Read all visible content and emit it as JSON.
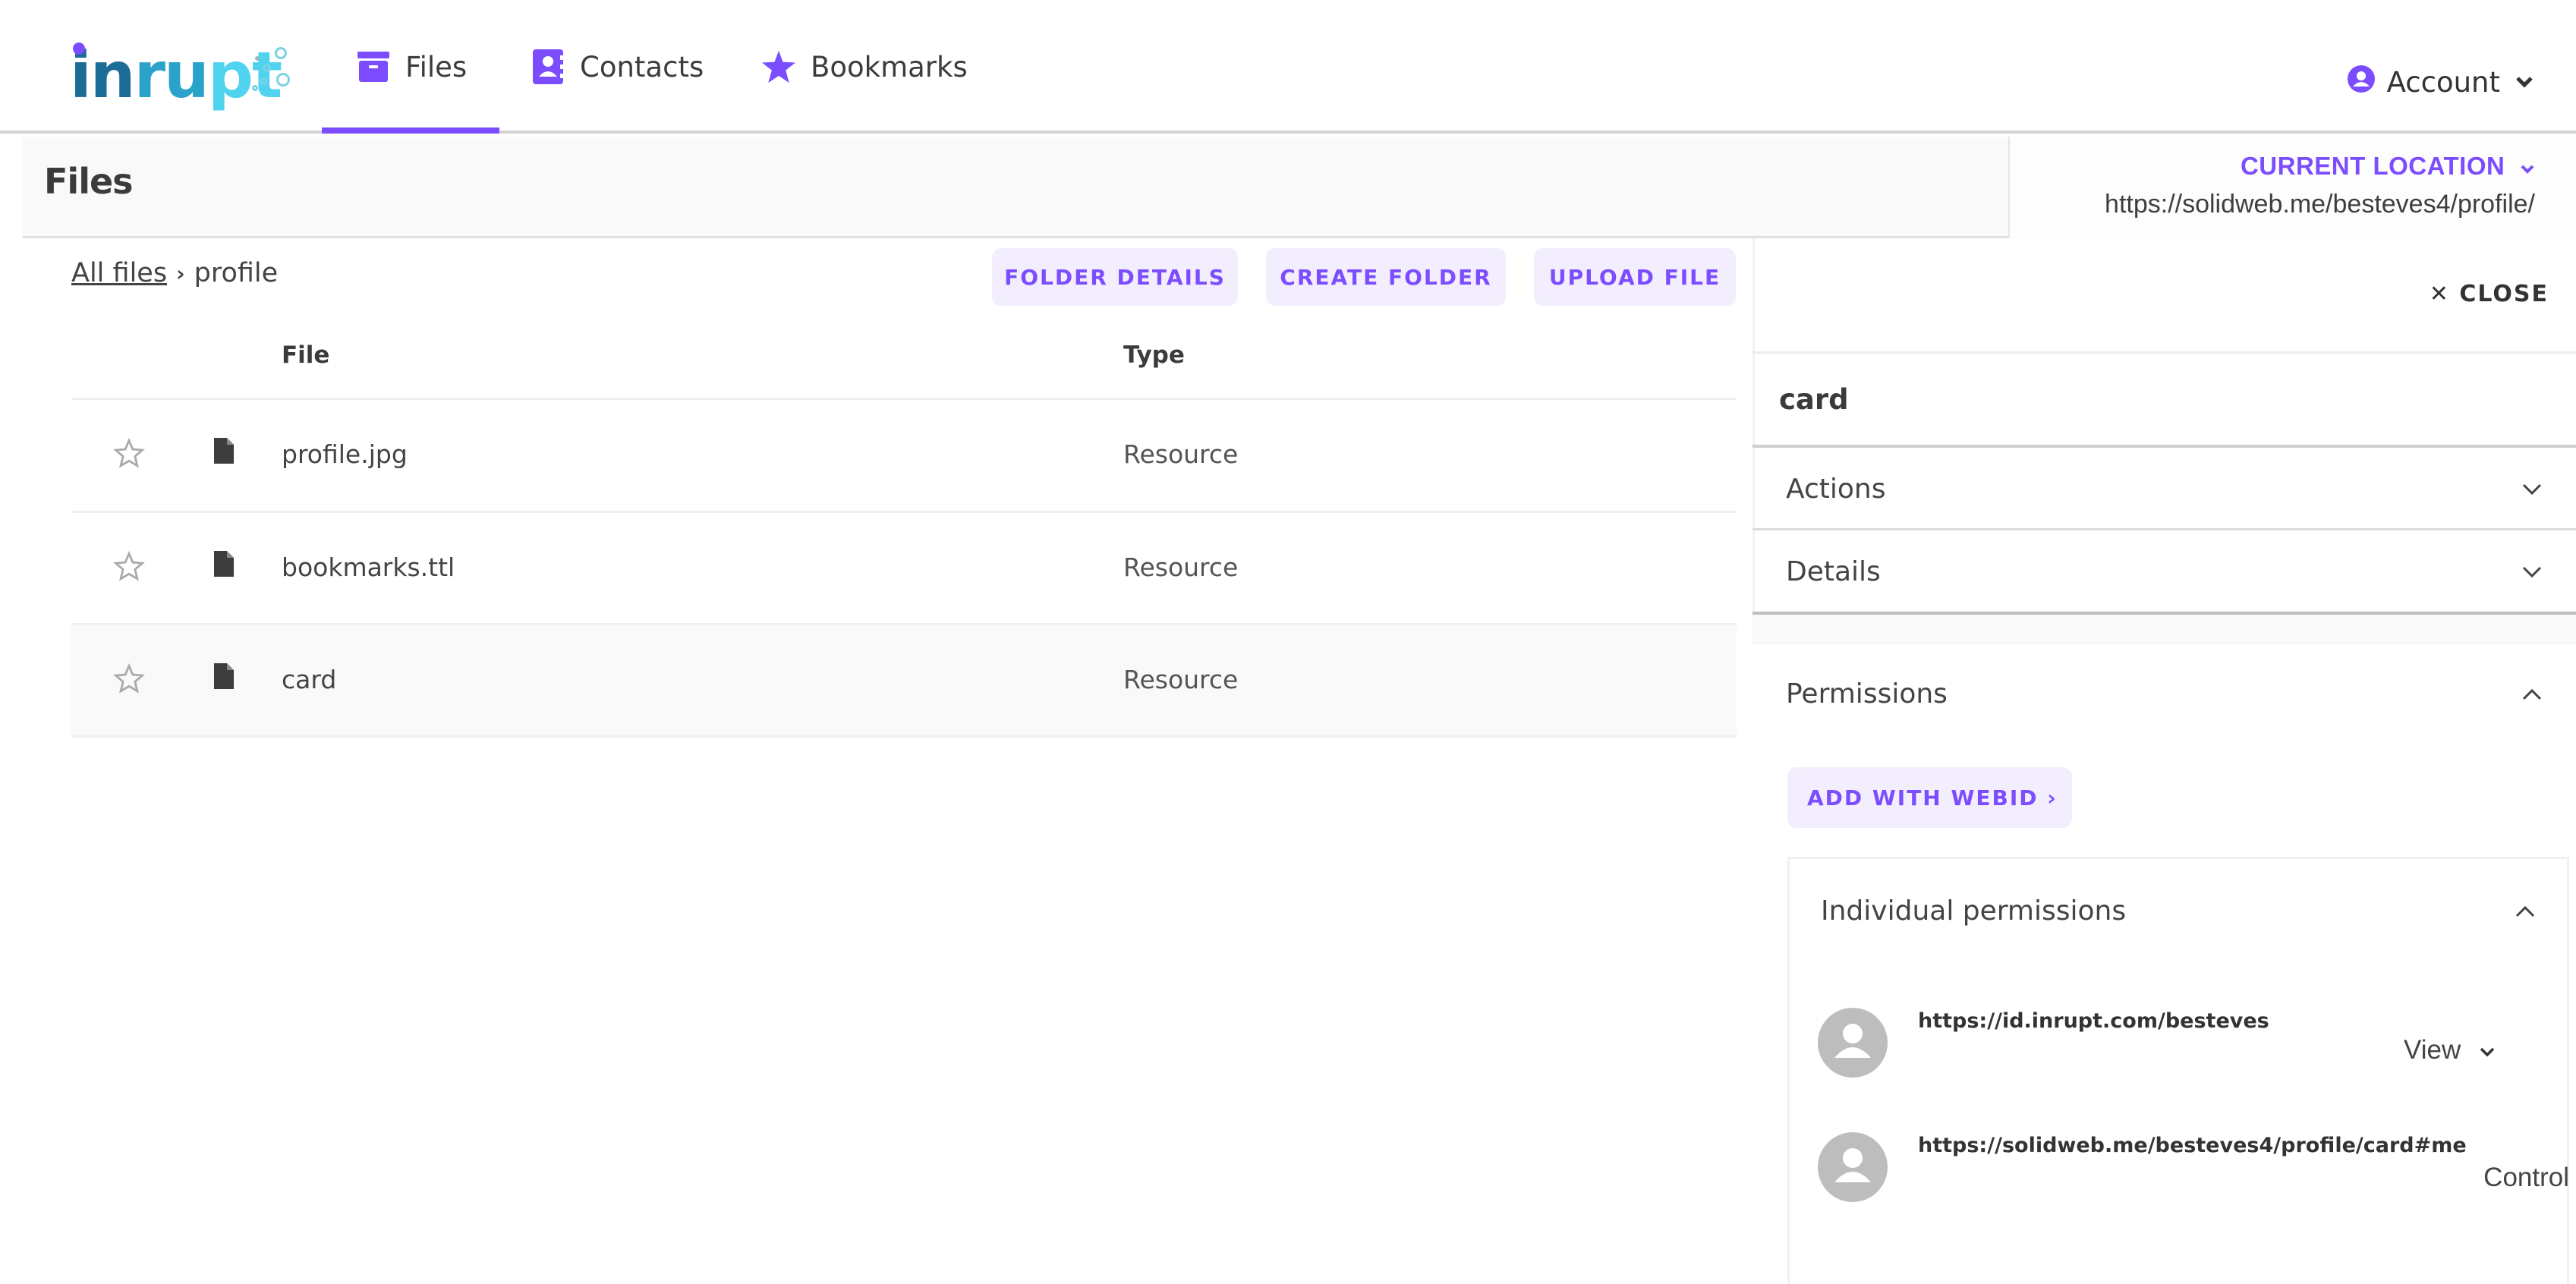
{
  "brand": {
    "logo_text_1": "in",
    "logo_text_2": "ru",
    "logo_text_3": "pt",
    "accent": "#7c4dff"
  },
  "nav": {
    "tabs": [
      {
        "label": "Files",
        "icon": "archive-box-icon",
        "active": true
      },
      {
        "label": "Contacts",
        "icon": "contact-book-icon",
        "active": false
      },
      {
        "label": "Bookmarks",
        "icon": "star-icon",
        "active": false
      }
    ],
    "account_label": "Account"
  },
  "header": {
    "title": "Files",
    "current_location_label": "CURRENT LOCATION",
    "current_location_url": "https://solidweb.me/besteves4/profile/"
  },
  "breadcrumb": {
    "root": "All files",
    "separator": "›",
    "current": "profile"
  },
  "toolbar": {
    "folder_details": "FOLDER DETAILS",
    "create_folder": "CREATE FOLDER",
    "upload_file": "UPLOAD FILE"
  },
  "table": {
    "columns": [
      "File",
      "Type"
    ],
    "rows": [
      {
        "name": "profile.jpg",
        "type": "Resource",
        "selected": false
      },
      {
        "name": "bookmarks.ttl",
        "type": "Resource",
        "selected": false
      },
      {
        "name": "card",
        "type": "Resource",
        "selected": true
      }
    ]
  },
  "panel": {
    "close_label": "✕ CLOSE",
    "resource_name": "card",
    "sections": {
      "actions": "Actions",
      "details": "Details",
      "permissions": "Permissions"
    },
    "add_webid_label": "ADD WITH WEBID ›",
    "individual_permissions_label": "Individual permissions",
    "agents": [
      {
        "webid": "https://id.inrupt.com/besteves",
        "permission": "View"
      },
      {
        "webid": "https://solidweb.me/besteves4/profile/card#me",
        "permission": "Control"
      }
    ]
  }
}
